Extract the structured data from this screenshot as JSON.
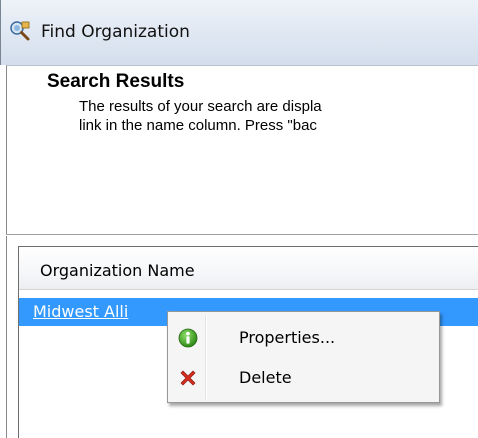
{
  "window": {
    "title": "Find Organization",
    "icon": "find-organization-icon"
  },
  "content": {
    "heading": "Search Results",
    "description_lines": [
      "The results of your search are displa",
      "link in the name column.  Press \"bac"
    ]
  },
  "results": {
    "column_header": "Organization Name",
    "rows": [
      {
        "name": "Midwest Alli"
      }
    ],
    "selected_row_color": "#3399ff"
  },
  "context_menu": {
    "items": [
      {
        "label": "Properties...",
        "icon": "info-icon",
        "icon_color": "#3e9b23"
      },
      {
        "label": "Delete",
        "icon": "delete-x-icon",
        "icon_color": "#d42d1e"
      }
    ]
  }
}
